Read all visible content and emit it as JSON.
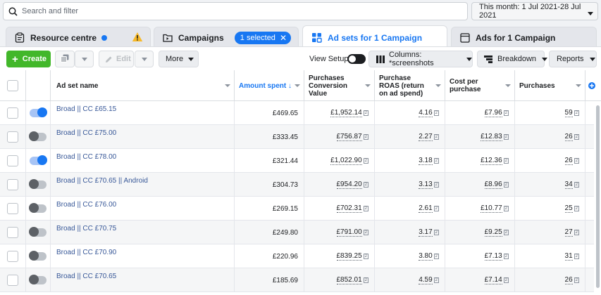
{
  "search": {
    "placeholder": "Search and filter"
  },
  "date_range": {
    "label": "This month: 1 Jul 2021-28 Jul 2021"
  },
  "tabs": [
    {
      "label": "Resource centre"
    },
    {
      "label": "Campaigns"
    },
    {
      "label": "Ad sets for 1 Campaign",
      "selected_pill": "1 selected"
    },
    {
      "label": "Ads for 1 Campaign"
    }
  ],
  "toolbar": {
    "create_label": "Create",
    "edit_label": "Edit",
    "more_label": "More",
    "view_setup_label": "View Setup",
    "columns_label": "Columns: *screenshots",
    "breakdown_label": "Breakdown",
    "reports_label": "Reports"
  },
  "table": {
    "headers": {
      "name": "Ad set name",
      "spent": "Amount spent ↓",
      "pcv": "Purchases Conversion Value",
      "roas": "Purchase ROAS (return on ad spend)",
      "cpp": "Cost per purchase",
      "purchases": "Purchases"
    },
    "rows": [
      {
        "on": true,
        "name": "Broad || CC £65.15",
        "spent": "£469.65",
        "pcv": "£1,952.14",
        "roas": "4.16",
        "cpp": "£7.96",
        "purchases": "59"
      },
      {
        "on": false,
        "name": "Broad || CC £75.00",
        "spent": "£333.45",
        "pcv": "£756.87",
        "roas": "2.27",
        "cpp": "£12.83",
        "purchases": "26"
      },
      {
        "on": true,
        "name": "Broad || CC £78.00",
        "spent": "£321.44",
        "pcv": "£1,022.90",
        "roas": "3.18",
        "cpp": "£12.36",
        "purchases": "26"
      },
      {
        "on": false,
        "name": "Broad || CC £70.65 || Android",
        "spent": "£304.73",
        "pcv": "£954.20",
        "roas": "3.13",
        "cpp": "£8.96",
        "purchases": "34"
      },
      {
        "on": false,
        "name": "Broad || CC £76.00",
        "spent": "£269.15",
        "pcv": "£702.31",
        "roas": "2.61",
        "cpp": "£10.77",
        "purchases": "25"
      },
      {
        "on": false,
        "name": "Broad || CC £70.75",
        "spent": "£249.80",
        "pcv": "£791.00",
        "roas": "3.17",
        "cpp": "£9.25",
        "purchases": "27"
      },
      {
        "on": false,
        "name": "Broad || CC £70.90",
        "spent": "£220.96",
        "pcv": "£839.25",
        "roas": "3.80",
        "cpp": "£7.13",
        "purchases": "31"
      },
      {
        "on": false,
        "name": "Broad || CC £70.65",
        "spent": "£185.69",
        "pcv": "£852.01",
        "roas": "4.59",
        "cpp": "£7.14",
        "purchases": "26"
      }
    ]
  },
  "colors": {
    "accent": "#1877f2",
    "create": "#42b72a",
    "warning": "#f7b928"
  },
  "icons": [
    "search-icon",
    "clipboard-icon",
    "warning-icon",
    "folder-icon",
    "grid-icon",
    "ad-icon",
    "duplicate-icon",
    "pencil-icon",
    "columns-icon",
    "breakdown-icon",
    "add-column-icon"
  ]
}
